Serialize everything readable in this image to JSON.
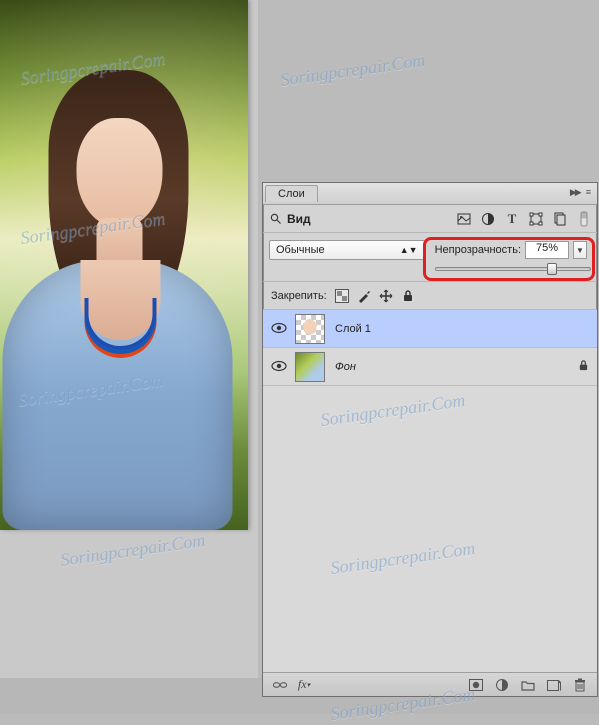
{
  "watermark_text": "Soringpcrepair.Com",
  "panel": {
    "tab_label": "Слои",
    "filter": {
      "search_label": "Вид"
    },
    "blend": {
      "mode_label": "Обычные",
      "opacity_label": "Непрозрачность:",
      "opacity_value": "75%",
      "opacity_percent": 75
    },
    "lock": {
      "label": "Закрепить:"
    },
    "layers": [
      {
        "name": "Слой 1",
        "selected": true,
        "locked": false,
        "kind": "masked"
      },
      {
        "name": "Фон",
        "selected": false,
        "locked": true,
        "kind": "background"
      }
    ],
    "footer_icons": [
      "link",
      "fx",
      "mask",
      "adjust",
      "group",
      "new",
      "trash"
    ]
  }
}
